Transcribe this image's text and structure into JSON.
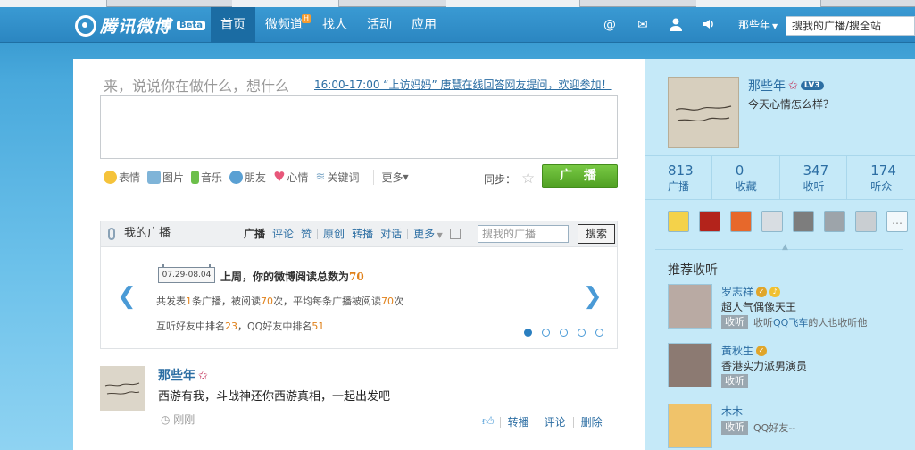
{
  "topnav": {
    "logo_text": "腾讯微博",
    "logo_badge": "Beta",
    "items": [
      {
        "label": "首页"
      },
      {
        "label": "微频道",
        "badge": "H"
      },
      {
        "label": "找人"
      },
      {
        "label": "活动"
      },
      {
        "label": "应用"
      }
    ],
    "icons": [
      "at-icon",
      "mail-icon",
      "user-icon",
      "speaker-icon"
    ],
    "user_menu": "那些年",
    "search_value": "搜我的广播/搜全站"
  },
  "compose": {
    "hint": "来，说说你在做什么，想什么",
    "topic_link": "16:00-17:00 “上访妈妈” 唐慧在线回答网友提问，欢迎参加！",
    "tools": [
      "表情",
      "图片",
      "音乐",
      "朋友",
      "心情",
      "关键词"
    ],
    "more": "更多",
    "sync_label": "同步：",
    "broadcast_button": "广 播"
  },
  "my_broadcast": {
    "title": "我的广播",
    "tabs": [
      "广播",
      "评论",
      "赞",
      "原创",
      "转播",
      "对话",
      "更多"
    ],
    "search_placeholder": "搜我的广播",
    "search_button": "搜索"
  },
  "stats_card": {
    "date_range": "07.29-08.04",
    "title_prefix": "上周，你的微博阅读总数为",
    "title_value": "70",
    "line1_a": "共发表",
    "line1_b": "1",
    "line1_c": "条广播，被阅读",
    "line1_d": "70",
    "line1_e": "次，平均每条广播被阅读",
    "line1_f": "70",
    "line1_g": "次",
    "line2_a": "互听好友中排名",
    "line2_b": "23",
    "line2_c": "，QQ好友中排名",
    "line2_d": "51",
    "dots_count": 5,
    "dots_active": 0
  },
  "post": {
    "author": "那些年",
    "text": "西游有我，斗战神还你西游真相，一起出发吧",
    "time": "刚刚",
    "actions": [
      "转播",
      "评论",
      "删除"
    ]
  },
  "sidebar": {
    "name": "那些年",
    "level": "LV3",
    "mood": "今天心情怎么样？",
    "stats": [
      {
        "num": "813",
        "label": "广播"
      },
      {
        "num": "0",
        "label": "收藏"
      },
      {
        "num": "347",
        "label": "收听"
      },
      {
        "num": "174",
        "label": "听众"
      }
    ],
    "apps": [
      {
        "icon": "phone-app-icon",
        "color": "#f4d24a"
      },
      {
        "icon": "game-app-icon",
        "color": "#b3231b"
      },
      {
        "icon": "pet-app-icon",
        "color": "#e7682b"
      },
      {
        "icon": "snow-app-icon",
        "color": "#d8dde2"
      },
      {
        "icon": "photo-app-icon",
        "color": "#7d7d7d"
      },
      {
        "icon": "fish-app-icon",
        "color": "#9da4aa"
      },
      {
        "icon": "badge-app-icon",
        "color": "#c9ced2"
      },
      {
        "icon": "more-apps-icon",
        "color": "#f2f8fb"
      }
    ],
    "rec_title": "推荐收听",
    "follow_label": "收听",
    "recommendations": [
      {
        "name": "罗志祥",
        "desc": "超人气偶像天王",
        "extra_a": "收听",
        "extra_link": "QQ飞车",
        "extra_b": "的人也收听他",
        "color": "#b9aaa3"
      },
      {
        "name": "黄秋生",
        "desc": "香港实力派男演员",
        "extra_a": "",
        "extra_link": "",
        "extra_b": "",
        "color": "#8c7a72"
      },
      {
        "name": "木木",
        "desc": "",
        "extra_a": "QQ好友--",
        "extra_link": "",
        "extra_b": "",
        "color": "#f0c36a"
      }
    ]
  }
}
